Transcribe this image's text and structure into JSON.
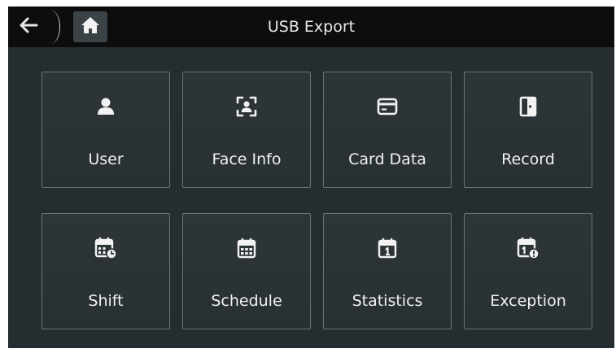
{
  "header": {
    "title": "USB Export"
  },
  "tiles": [
    {
      "label": "User",
      "icon": "user-icon"
    },
    {
      "label": "Face Info",
      "icon": "face-scan-icon"
    },
    {
      "label": "Card Data",
      "icon": "card-icon"
    },
    {
      "label": "Record",
      "icon": "door-icon"
    },
    {
      "label": "Shift",
      "icon": "calendar-clock-icon"
    },
    {
      "label": "Schedule",
      "icon": "calendar-grid-icon"
    },
    {
      "label": "Statistics",
      "icon": "calendar-one-icon"
    },
    {
      "label": "Exception",
      "icon": "calendar-alert-icon"
    }
  ],
  "colors": {
    "background": "#262d31",
    "topbar": "#0d0d0d",
    "tile_border": "#6a7377",
    "text": "#f0f0f0"
  }
}
